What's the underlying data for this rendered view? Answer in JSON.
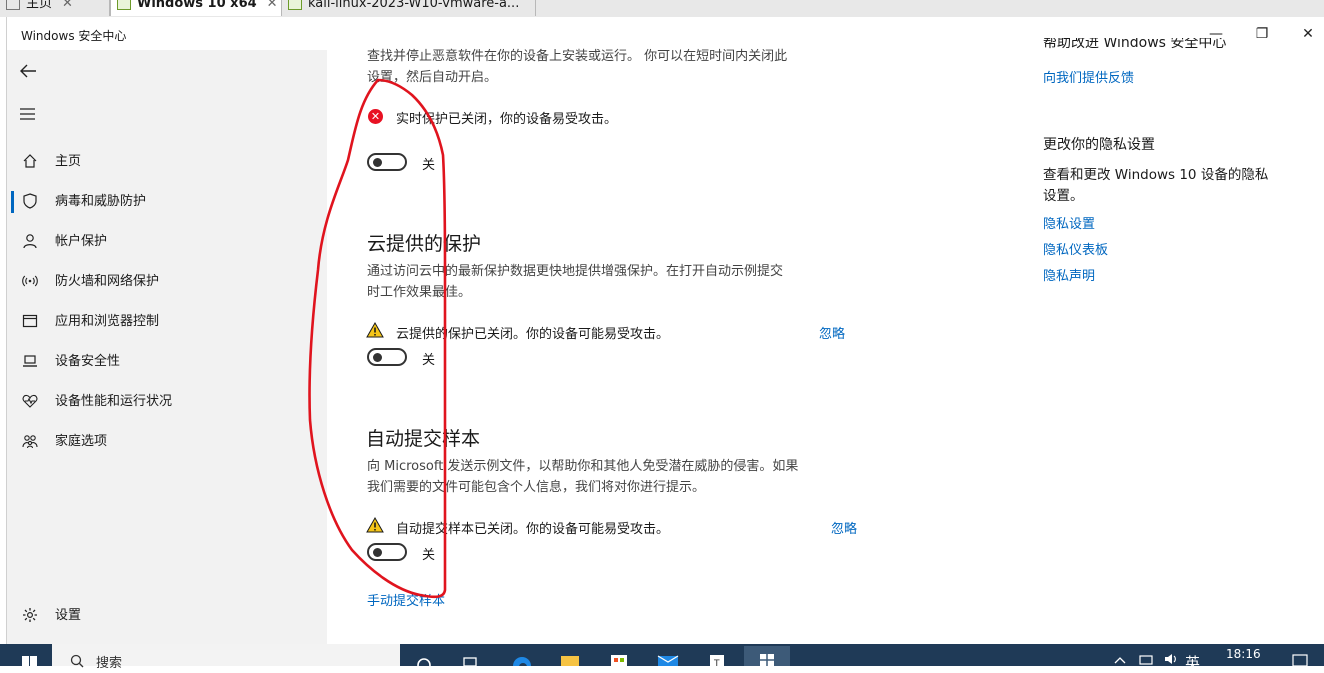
{
  "vm_tabs": [
    {
      "label": "主页"
    },
    {
      "label": "Windows 10 x64"
    },
    {
      "label": "kali-linux-2023-W10-vmware-a..."
    }
  ],
  "window": {
    "title": "Windows 安全中心",
    "minimize": "—",
    "maximize": "❐",
    "close": "✕"
  },
  "nav": {
    "back_icon": "back-arrow-icon",
    "menu_icon": "hamburger-icon",
    "items": [
      {
        "label": "主页",
        "icon": "home-icon"
      },
      {
        "label": "病毒和威胁防护",
        "icon": "shield-icon",
        "selected": true
      },
      {
        "label": "帐户保护",
        "icon": "person-icon"
      },
      {
        "label": "防火墙和网络保护",
        "icon": "wifi-icon"
      },
      {
        "label": "应用和浏览器控制",
        "icon": "app-window-icon"
      },
      {
        "label": "设备安全性",
        "icon": "laptop-icon"
      },
      {
        "label": "设备性能和运行状况",
        "icon": "heart-icon"
      },
      {
        "label": "家庭选项",
        "icon": "family-icon"
      }
    ],
    "settings": {
      "label": "设置",
      "icon": "gear-icon"
    }
  },
  "main": {
    "realtime": {
      "desc_line1": "查找并停止恶意软件在你的设备上安装或运行。 你可以在短时间内关闭此",
      "desc_line2": "设置，然后自动开启。",
      "status": "实时保护已关闭，你的设备易受攻击。",
      "toggle_label": "关",
      "toggle_on": false
    },
    "cloud": {
      "title": "云提供的保护",
      "desc_line1": "通过访问云中的最新保护数据更快地提供增强保护。在打开自动示例提交",
      "desc_line2": "时工作效果最佳。",
      "status": "云提供的保护已关闭。你的设备可能易受攻击。",
      "dismiss": "忽略",
      "toggle_label": "关",
      "toggle_on": false
    },
    "sample": {
      "title": "自动提交样本",
      "desc_line1": "向 Microsoft 发送示例文件，以帮助你和其他人免受潜在威胁的侵害。如果",
      "desc_line2": "我们需要的文件可能包含个人信息，我们将对你进行提示。",
      "status": "自动提交样本已关闭。你的设备可能易受攻击。",
      "dismiss": "忽略",
      "toggle_label": "关",
      "toggle_on": false,
      "manual_link": "手动提交样本"
    }
  },
  "right": {
    "help_partial": "帮助改进 Windows 安全中心",
    "feedback_link": "向我们提供反馈",
    "privacy_title": "更改你的隐私设置",
    "privacy_desc_line1": "查看和更改 Windows 10 设备的隐私",
    "privacy_desc_line2": "设置。",
    "links": [
      "隐私设置",
      "隐私仪表板",
      "隐私声明"
    ]
  },
  "taskbar": {
    "search_placeholder": "搜索",
    "ime": "英",
    "time": "18:16"
  },
  "colors": {
    "accent": "#0067c0",
    "annotation": "#e0141e",
    "error": "#e81123",
    "warning": "#f5c518"
  }
}
